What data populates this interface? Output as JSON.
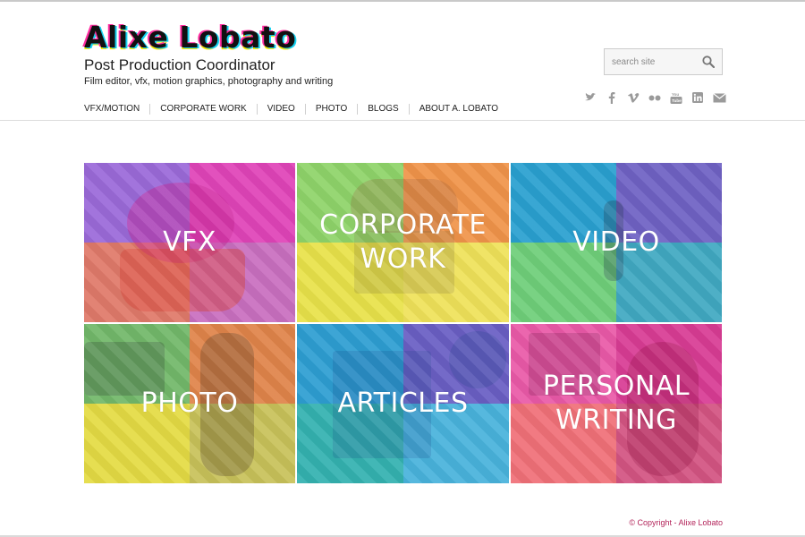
{
  "site": {
    "name": "Alixe Lobato",
    "tagline": "Post Production Coordinator",
    "subline": "Film editor, vfx, motion graphics, photography and writing"
  },
  "nav": {
    "items": [
      {
        "label": "VFX/MOTION"
      },
      {
        "label": "CORPORATE WORK"
      },
      {
        "label": "VIDEO"
      },
      {
        "label": "PHOTO"
      },
      {
        "label": "BLOGS"
      },
      {
        "label": "ABOUT A. LOBATO"
      }
    ]
  },
  "search": {
    "placeholder": "search site",
    "icon": "magnifier-icon"
  },
  "social": {
    "icons": [
      "twitter-icon",
      "facebook-icon",
      "vimeo-icon",
      "flickr-icon",
      "youtube-icon",
      "linkedin-icon",
      "email-icon"
    ]
  },
  "tiles": [
    {
      "label": "VFX",
      "colors": [
        "#9b6ad9",
        "#e044b8",
        "#e07a6a",
        "#c96fc0"
      ]
    },
    {
      "label": "CORPORATE WORK",
      "colors": [
        "#8fd46a",
        "#f0944a",
        "#e8e24a",
        "#efe25a"
      ]
    },
    {
      "label": "VIDEO",
      "colors": [
        "#2aa0d0",
        "#6f62c4",
        "#6fcf7a",
        "#41a9c2"
      ]
    },
    {
      "label": "PHOTO",
      "colors": [
        "#72b86a",
        "#e0844a",
        "#e4db44",
        "#c8c25a"
      ]
    },
    {
      "label": "ARTICLES",
      "colors": [
        "#2e9ed2",
        "#6a5fc4",
        "#34b2b0",
        "#49b3dc"
      ]
    },
    {
      "label": "PERSONAL WRITING",
      "colors": [
        "#ea5aa8",
        "#d83c94",
        "#f07078",
        "#d35482"
      ]
    }
  ],
  "footer": {
    "copyright": "© Copyright - Alixe Lobato"
  },
  "colors": {
    "accent": "#b3245a",
    "nav_text": "#222222",
    "icon_gray": "#9a9a9a"
  }
}
